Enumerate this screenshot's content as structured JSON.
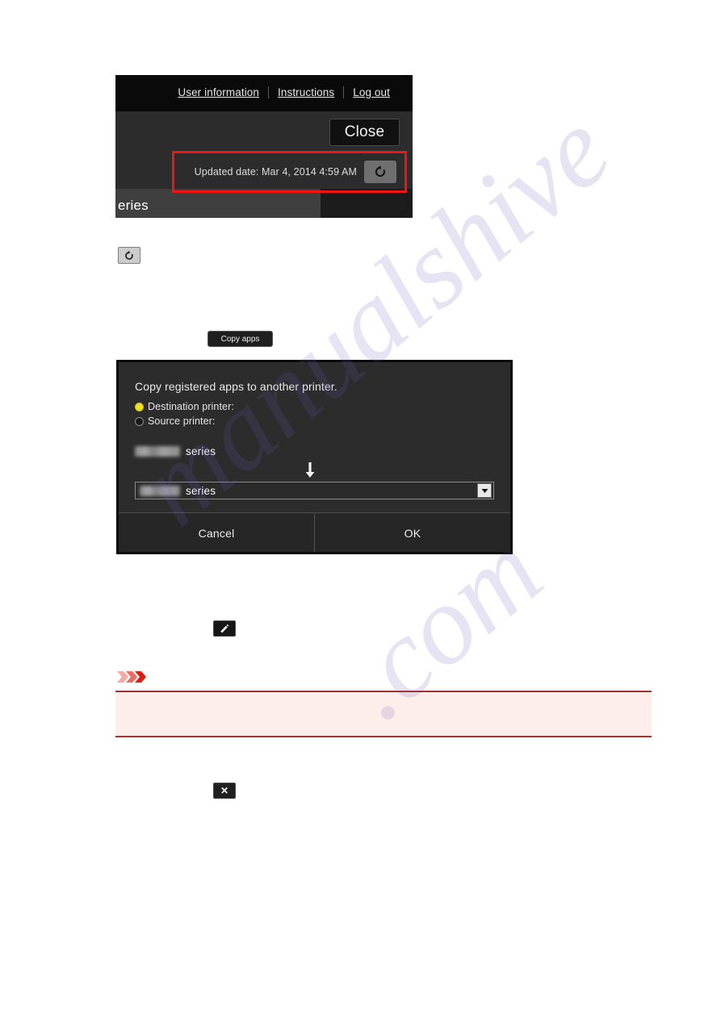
{
  "printer_panel": {
    "nav": {
      "user_information": "User information",
      "instructions": "Instructions",
      "log_out": "Log out"
    },
    "close_button": "Close",
    "updated_date": "Updated date: Mar 4, 2014 4:59 AM",
    "refresh_icon": "refresh-icon",
    "series_label": "eries"
  },
  "standalone_refresh": {
    "icon": "refresh-icon"
  },
  "copy_apps_button": {
    "label": "Copy apps"
  },
  "copy_apps_dialog": {
    "title": "Copy registered apps to another printer.",
    "options": [
      {
        "label": "Destination printer:",
        "selected": true
      },
      {
        "label": "Source printer:",
        "selected": false
      }
    ],
    "source_printer": {
      "model": "",
      "suffix": "series"
    },
    "arrow_icon": "down-arrow-icon",
    "destination_printer": {
      "model": "",
      "suffix": "series",
      "dropdown_icon": "chevron-down-icon"
    },
    "buttons": {
      "cancel": "Cancel",
      "ok": "OK"
    }
  },
  "edit_button": {
    "icon": "pencil-icon"
  },
  "notice": {
    "marker_icon": "triple-chevron-icon",
    "text": ""
  },
  "close_icon_button": {
    "icon": "close-x-icon",
    "glyph": "✕"
  },
  "watermark": {
    "line_a": "manualshive",
    "line_b": ".com"
  },
  "colors": {
    "panel_bg": "#2b2b2b",
    "topbar_bg": "#0a0a0a",
    "highlight_red": "#f01414",
    "radio_selected": "#f2e21a",
    "notice_bg": "#fdeeeb",
    "notice_border": "#9e3330"
  }
}
